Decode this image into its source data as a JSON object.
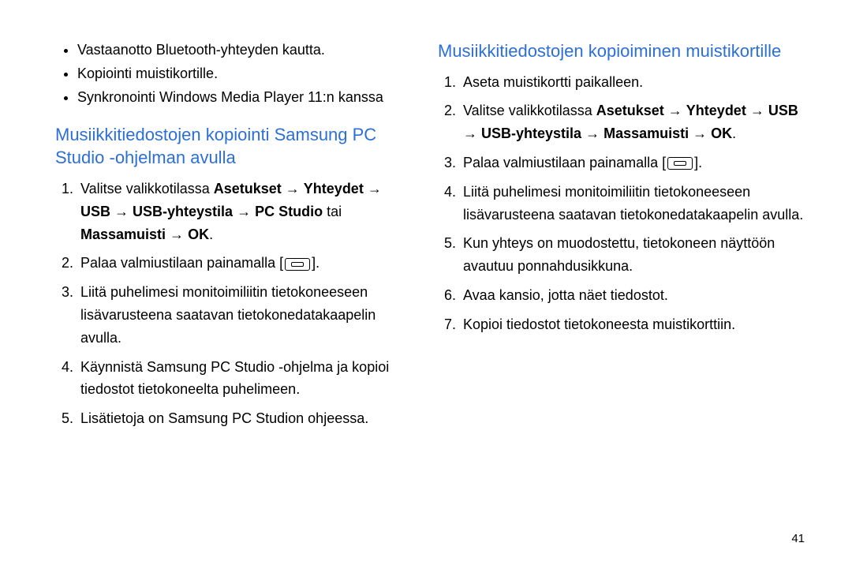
{
  "left": {
    "bullets": [
      "Vastaanotto Bluetooth-yhteyden kautta.",
      "Kopiointi muistikortille.",
      "Synkronointi Windows Media Player 11:n kanssa"
    ],
    "heading": "Musiikkitiedostojen kopiointi Samsung PC Studio -ohjelman avulla",
    "step1": {
      "a": "Valitse valikkotilassa ",
      "b": "Asetukset",
      "c": " → ",
      "d": "Yhteydet",
      "e": " → ",
      "f": "USB",
      "g": " → ",
      "h": "USB-yhteystila",
      "i": " → ",
      "j": "PC Studio",
      "k": " tai ",
      "l": "Massamuisti",
      "m": " → ",
      "n": "OK",
      "o": "."
    },
    "step2": {
      "a": "Palaa valmiustilaan painamalla [",
      "b": "]."
    },
    "step3": "Liitä puhelimesi monitoimiliitin tietokoneeseen lisävarusteena saatavan tietokonedatakaapelin avulla.",
    "step4": "Käynnistä Samsung PC Studio -ohjelma ja kopioi tiedostot tietokoneelta puhelimeen.",
    "step5": "Lisätietoja on Samsung PC Studion ohjeessa."
  },
  "right": {
    "heading": "Musiikkitiedostojen kopioiminen muistikortille",
    "step1": "Aseta muistikortti paikalleen.",
    "step2": {
      "a": "Valitse valikkotilassa ",
      "b": "Asetukset",
      "c": " → ",
      "d": "Yhteydet",
      "e": " → ",
      "f": "USB",
      "g": " → ",
      "h": "USB-yhteystila",
      "i": " → ",
      "j": "Massamuisti",
      "k": " → ",
      "l": "OK",
      "m": "."
    },
    "step3": {
      "a": "Palaa valmiustilaan painamalla [",
      "b": "]."
    },
    "step4": "Liitä puhelimesi monitoimiliitin tietokoneeseen lisävarusteena saatavan tietokonedatakaapelin avulla.",
    "step5": "Kun yhteys on muodostettu, tietokoneen näyttöön avautuu ponnahdusikkuna.",
    "step6": "Avaa kansio, jotta näet tiedostot.",
    "step7": "Kopioi tiedostot tietokoneesta muistikorttiin."
  },
  "page_number": "41"
}
